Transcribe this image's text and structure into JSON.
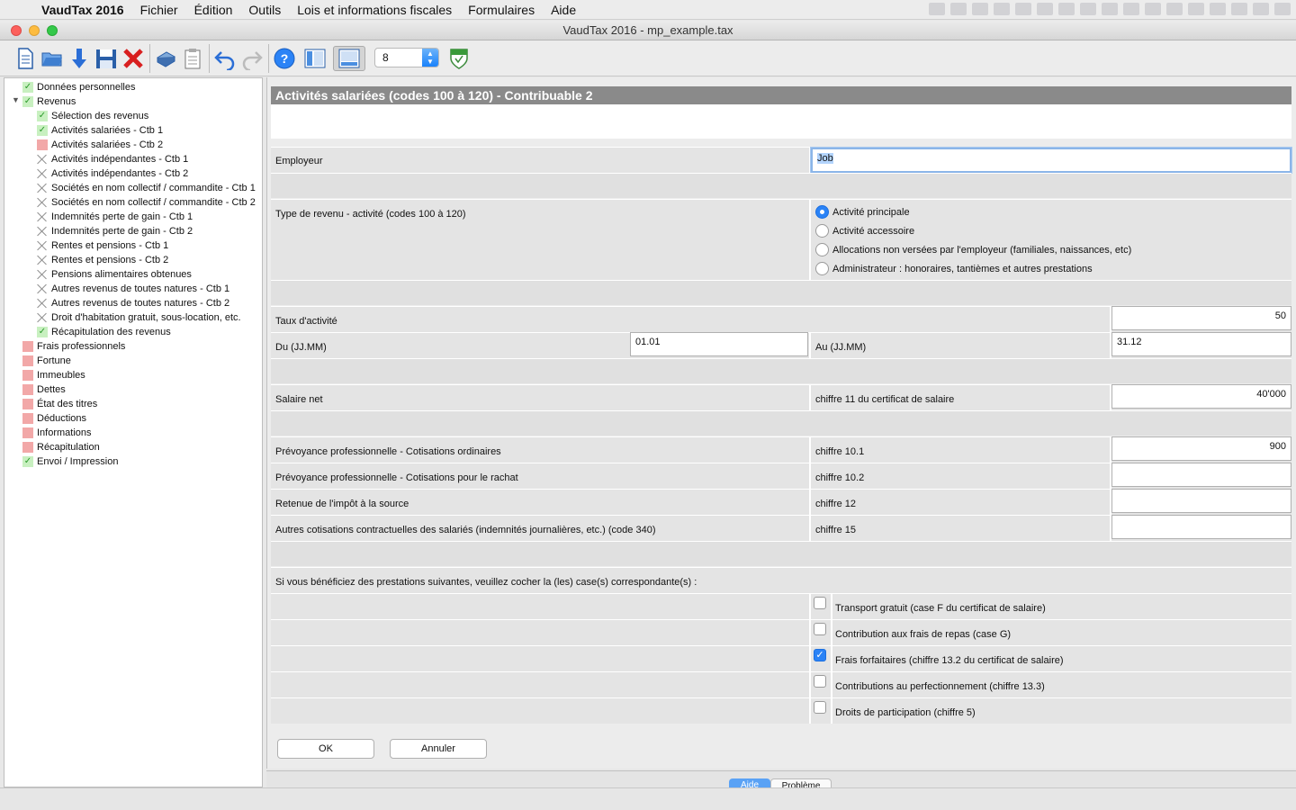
{
  "menubar": {
    "app_name": "VaudTax 2016",
    "items": [
      "Fichier",
      "Édition",
      "Outils",
      "Lois et informations fiscales",
      "Formulaires",
      "Aide"
    ]
  },
  "window": {
    "title": "VaudTax 2016 - mp_example.tax"
  },
  "toolbar": {
    "zoom_value": "8"
  },
  "sidebar": {
    "items": [
      {
        "label": "Données personnelles",
        "status": "ok"
      },
      {
        "label": "Revenus",
        "status": "ok"
      },
      {
        "label": "Sélection des revenus",
        "status": "ok"
      },
      {
        "label": "Activités salariées - Ctb 1",
        "status": "ok"
      },
      {
        "label": "Activités salariées - Ctb 2",
        "status": "err"
      },
      {
        "label": "Activités indépendantes - Ctb 1",
        "status": "na"
      },
      {
        "label": "Activités indépendantes - Ctb 2",
        "status": "na"
      },
      {
        "label": "Sociétés en nom collectif / commandite - Ctb 1",
        "status": "na"
      },
      {
        "label": "Sociétés en nom collectif / commandite - Ctb 2",
        "status": "na"
      },
      {
        "label": "Indemnités perte de gain - Ctb 1",
        "status": "na"
      },
      {
        "label": "Indemnités perte de gain - Ctb 2",
        "status": "na"
      },
      {
        "label": "Rentes et pensions - Ctb 1",
        "status": "na"
      },
      {
        "label": "Rentes et pensions - Ctb 2",
        "status": "na"
      },
      {
        "label": "Pensions alimentaires obtenues",
        "status": "na"
      },
      {
        "label": "Autres revenus de toutes natures - Ctb 1",
        "status": "na"
      },
      {
        "label": "Autres revenus de toutes natures - Ctb 2",
        "status": "na"
      },
      {
        "label": "Droit d'habitation gratuit, sous-location, etc.",
        "status": "na"
      },
      {
        "label": "Récapitulation des revenus",
        "status": "ok"
      },
      {
        "label": "Frais professionnels",
        "status": "err"
      },
      {
        "label": "Fortune",
        "status": "err"
      },
      {
        "label": "Immeubles",
        "status": "err"
      },
      {
        "label": "Dettes",
        "status": "err"
      },
      {
        "label": "État des titres",
        "status": "err"
      },
      {
        "label": "Déductions",
        "status": "err"
      },
      {
        "label": "Informations",
        "status": "err"
      },
      {
        "label": "Récapitulation",
        "status": "err"
      },
      {
        "label": "Envoi / Impression",
        "status": "ok"
      }
    ]
  },
  "form": {
    "title": "Activités salariées (codes 100 à 120) - Contribuable 2",
    "employeur_label": "Employeur",
    "employeur_value": "Job",
    "type_label": "Type de revenu - activité (codes 100 à 120)",
    "type_options": [
      {
        "label": "Activité principale",
        "selected": true
      },
      {
        "label": "Activité accessoire",
        "selected": false
      },
      {
        "label": "Allocations non versées par l'employeur (familiales, naissances, etc)",
        "selected": false
      },
      {
        "label": "Administrateur : honoraires, tantièmes et autres prestations",
        "selected": false
      }
    ],
    "taux_label": "Taux d'activité",
    "taux_value": "50",
    "du_label": "Du (JJ.MM)",
    "du_value": "01.01",
    "au_label": "Au (JJ.MM)",
    "au_value": "31.12",
    "salaire_label": "Salaire net",
    "salaire_chiffre": "chiffre 11 du certificat de salaire",
    "salaire_value": "40'000",
    "prev_ord_label": "Prévoyance professionnelle - Cotisations ordinaires",
    "prev_ord_chiffre": "chiffre 10.1",
    "prev_ord_value": "900",
    "prev_rachat_label": "Prévoyance professionnelle - Cotisations pour le rachat",
    "prev_rachat_chiffre": "chiffre 10.2",
    "prev_rachat_value": "",
    "retenue_label": "Retenue de l'impôt à la source",
    "retenue_chiffre": "chiffre 12",
    "retenue_value": "",
    "autres_label": "Autres cotisations contractuelles des salariés (indemnités journalières, etc.) (code 340)",
    "autres_chiffre": "chiffre 15",
    "autres_value": "",
    "prestations_intro": "Si vous bénéficiez des prestations suivantes, veuillez cocher la (les) case(s) correspondante(s) :",
    "prestations": [
      {
        "label": "Transport gratuit (case F du certificat de salaire)",
        "checked": false
      },
      {
        "label": "Contribution aux frais de repas (case G)",
        "checked": false
      },
      {
        "label": "Frais forfaitaires (chiffre 13.2 du certificat de salaire)",
        "checked": true
      },
      {
        "label": "Contributions au perfectionnement (chiffre 13.3)",
        "checked": false
      },
      {
        "label": "Droits de participation (chiffre 5)",
        "checked": false
      }
    ],
    "ok_label": "OK",
    "cancel_label": "Annuler"
  },
  "bottom_tabs": [
    "Aide",
    "Problème"
  ]
}
